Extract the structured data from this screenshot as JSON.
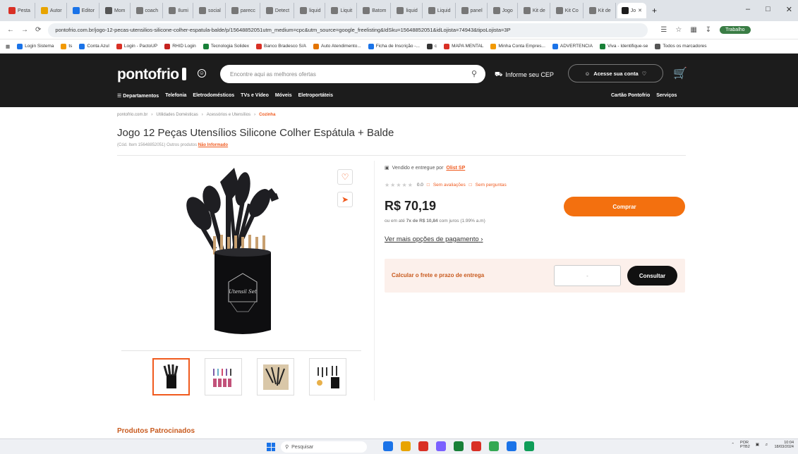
{
  "browser": {
    "tabs": [
      {
        "label": "Pesta",
        "color": "#d93025"
      },
      {
        "label": "Autor",
        "color": "#e8a400"
      },
      {
        "label": "Editor",
        "color": "#1a73e8"
      },
      {
        "label": "Mom",
        "color": "#555555"
      },
      {
        "label": "coach",
        "color": "#777777"
      },
      {
        "label": "Ilumi",
        "color": "#777777"
      },
      {
        "label": "social",
        "color": "#777777"
      },
      {
        "label": "parecc",
        "color": "#777777"
      },
      {
        "label": "Detect",
        "color": "#777777"
      },
      {
        "label": "liquid",
        "color": "#777777"
      },
      {
        "label": "Liquit",
        "color": "#777777"
      },
      {
        "label": "Batom",
        "color": "#777777"
      },
      {
        "label": "liquid",
        "color": "#777777"
      },
      {
        "label": "Liquid",
        "color": "#777777"
      },
      {
        "label": "panel",
        "color": "#777777"
      },
      {
        "label": "Jogo",
        "color": "#777777"
      },
      {
        "label": "Kit de",
        "color": "#777777"
      },
      {
        "label": "Kit Co",
        "color": "#777777"
      },
      {
        "label": "Kit de",
        "color": "#777777"
      }
    ],
    "active_tab": "Jo",
    "url": "pontofrio.com.br/jogo-12-pecas-utensilios-silicone-colher-espatula-balde/p/15648852051utm_medium=cpc&utm_source=google_freelisting&IdSku=15648852051&idLojista=74943&tipoLojista=3P",
    "profile": "Trabalho",
    "bookmarks": [
      {
        "label": "Login Sistema",
        "color": "#1a73e8"
      },
      {
        "label": "ts",
        "color": "#f29900"
      },
      {
        "label": "Conta Azul",
        "color": "#1a73e8"
      },
      {
        "label": "Login - PactoUP",
        "color": "#d93025"
      },
      {
        "label": "RHID Login",
        "color": "#c5221f"
      },
      {
        "label": "Tecnologia Solidex",
        "color": "#188038"
      },
      {
        "label": "Banco Bradesco S/A",
        "color": "#d93025"
      },
      {
        "label": "Auto Atendimento...",
        "color": "#e37400"
      },
      {
        "label": "Ficha de Inscrição -...",
        "color": "#1a73e8"
      },
      {
        "label": "c",
        "color": "#333333"
      },
      {
        "label": "MAPA MENTAL",
        "color": "#d93025"
      },
      {
        "label": "Minha Conta Empres...",
        "color": "#f29900"
      },
      {
        "label": "ADVERTENCIA",
        "color": "#1a73e8"
      },
      {
        "label": "Viva - Identifique-se",
        "color": "#188038"
      },
      {
        "label": "Todos os marcadores",
        "color": "#555555"
      }
    ]
  },
  "site": {
    "logo": "pontofrio",
    "search_placeholder": "Encontre aqui as melhores ofertas",
    "cep_label": "Informe seu CEP",
    "login_label": "Acesse sua conta",
    "nav": [
      "Departamentos",
      "Telefonia",
      "Eletrodomésticos",
      "TVs e Vídeo",
      "Móveis",
      "Eletroportáteis"
    ],
    "nav_right": [
      "Cartão Pontofrio",
      "Serviços"
    ]
  },
  "breadcrumb": [
    "pontofrio.com.br",
    "Utilidades Domésticas",
    "Acessórios e Utensílios",
    "Cozinha"
  ],
  "product": {
    "title": "Jogo 12 Peças Utensílios Silicone Colher Espátula + Balde",
    "sku_text": "(Cód. Item 15648852051)",
    "other_products": "Outros produtos",
    "brand": "Não Informado",
    "seller_prefix": "Vendido e entregue por",
    "seller": "Olist SP",
    "rating": "0.0",
    "reviews_link": "Sem avaliações",
    "questions_link": "Sem perguntas",
    "price": "R$ 70,19",
    "installment_prefix": "ou em até",
    "installment_bold": "7x de R$ 10,84",
    "installment_suffix": "com juros (1.99% a.m)",
    "buy_label": "Comprar",
    "more_payment": "Ver mais opções de pagamento",
    "freight_label": "Calcular o frete e prazo de entrega",
    "cep_placeholder": "-",
    "consult_label": "Consultar",
    "canister_text": "Utensil Set"
  },
  "sponsored_heading": "Produtos Patrocinados",
  "taskbar": {
    "search_label": "Pesquisar",
    "lang": "POR",
    "lang2": "PTB2",
    "time": "10:04",
    "date": "18/03/2024",
    "apps": [
      "#1a73e8",
      "#e8a400",
      "#d93025",
      "#7b61ff",
      "#188038",
      "#d93025",
      "#34a853",
      "#1a73e8",
      "#0f9d58"
    ]
  }
}
